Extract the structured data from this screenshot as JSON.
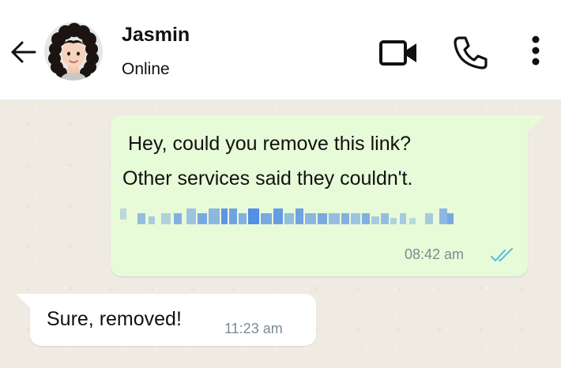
{
  "contact": {
    "name": "Jasmin",
    "status": "Online"
  },
  "messages": [
    {
      "direction": "outgoing",
      "lines": [
        "Hey, could you remove this link?",
        "Other services said they couldn't."
      ],
      "link": "redacted-link",
      "time": "08:42 am",
      "read_receipt": "double-tick-read"
    },
    {
      "direction": "incoming",
      "text": "Sure, removed!",
      "time": "11:23 am"
    }
  ],
  "colors": {
    "outgoing_bubble": "#e7fbd8",
    "incoming_bubble": "#ffffff",
    "chat_background": "#efeae2",
    "read_tick": "#53bdeb",
    "link_pixels": "#2f73e8"
  },
  "icons": {
    "back": "back-arrow-icon",
    "video": "video-camera-icon",
    "call": "phone-icon",
    "menu": "more-vertical-icon"
  }
}
